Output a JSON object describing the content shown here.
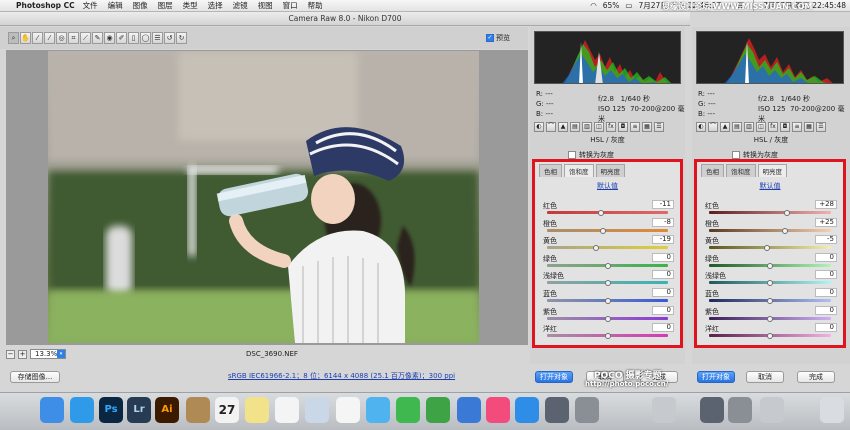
{
  "menubar": {
    "app_name": "Photoshop CC",
    "items": [
      "文件",
      "编辑",
      "图像",
      "图层",
      "类型",
      "选择",
      "滤镜",
      "视图",
      "窗口",
      "帮助"
    ],
    "battery": "65%",
    "clock_left": "7月27日 周三  22:46:17",
    "clock_right": "7月27日 周三  22:45:48",
    "watermark": "思缘设计论坛 WWW.MISSYUAN.COM"
  },
  "window": {
    "title": "Camera Raw 8.0 - Nikon D700"
  },
  "toolbar": {
    "tools": [
      "zoom-icon",
      "hand-icon",
      "white-balance-icon",
      "color-sampler-icon",
      "target-adjust-icon",
      "crop-icon",
      "straighten-icon",
      "spot-removal-icon",
      "red-eye-icon",
      "adjustment-brush-icon",
      "graduated-filter-icon",
      "radial-filter-icon",
      "preferences-icon",
      "rotate-ccw-icon",
      "rotate-cw-icon"
    ],
    "preview_label": "预览"
  },
  "canvas": {
    "filename": "DSC_3690.NEF",
    "zoom_value": "13.3%"
  },
  "bottom": {
    "save_label": "存储图像...",
    "workflow_info": "sRGB IEC61966-2.1；8 位；6144 x 4088 (25.1 百万像素)；300 ppi",
    "open_label": "打开对象",
    "cancel_label": "取消",
    "done_label": "完成",
    "watermark_url": "http://photo.poco.cn/",
    "watermark_brand": "POCO 摄影专题"
  },
  "exif": {
    "r": "R:  ---",
    "g": "G:  ---",
    "b": "B:  ---",
    "aperture": "f/2.8",
    "shutter": "1/640 秒",
    "iso": "ISO 125",
    "lens": "70-200@200 毫米"
  },
  "hsl_title": "HSL / 灰度",
  "grayscale_label": "转换为灰度",
  "default_label": "默认值",
  "tabs": [
    "色相",
    "饱和度",
    "明亮度"
  ],
  "saturation_panel": {
    "active_tab": 1,
    "rows": [
      {
        "label": "红色",
        "value": "-11",
        "level": -11,
        "color_from": "#c43a3a",
        "color_to": "#e06a6a"
      },
      {
        "label": "橙色",
        "value": "-8",
        "level": -8,
        "color_from": "#a88e6c",
        "color_to": "#e08a3a"
      },
      {
        "label": "黄色",
        "value": "-19",
        "level": -19,
        "color_from": "#a9a38c",
        "color_to": "#e0cf3a"
      },
      {
        "label": "绿色",
        "value": "0",
        "level": 0,
        "color_from": "#8fa18f",
        "color_to": "#3ab34a"
      },
      {
        "label": "浅绿色",
        "value": "0",
        "level": 0,
        "color_from": "#8fa1a1",
        "color_to": "#3ab3b3"
      },
      {
        "label": "蓝色",
        "value": "0",
        "level": 0,
        "color_from": "#8f96a6",
        "color_to": "#3a5ad6"
      },
      {
        "label": "紫色",
        "value": "0",
        "level": 0,
        "color_from": "#9b8fa6",
        "color_to": "#8a3ad6"
      },
      {
        "label": "洋红",
        "value": "0",
        "level": 0,
        "color_from": "#a68fa1",
        "color_to": "#d63ab3"
      }
    ]
  },
  "luminance_panel": {
    "active_tab": 2,
    "rows": [
      {
        "label": "红色",
        "value": "+28",
        "level": 28,
        "color_from": "#5a1f1f",
        "color_to": "#f4b0b0"
      },
      {
        "label": "橙色",
        "value": "+25",
        "level": 25,
        "color_from": "#5a3a1f",
        "color_to": "#f4d0b0"
      },
      {
        "label": "黄色",
        "value": "-5",
        "level": -5,
        "color_from": "#5a551f",
        "color_to": "#f4efb0"
      },
      {
        "label": "绿色",
        "value": "0",
        "level": 0,
        "color_from": "#1f5a25",
        "color_to": "#b0f4b8"
      },
      {
        "label": "浅绿色",
        "value": "0",
        "level": 0,
        "color_from": "#1f5a5a",
        "color_to": "#b0f4f4"
      },
      {
        "label": "蓝色",
        "value": "0",
        "level": 0,
        "color_from": "#1f2a5a",
        "color_to": "#b0c0f4"
      },
      {
        "label": "紫色",
        "value": "0",
        "level": 0,
        "color_from": "#3a1f5a",
        "color_to": "#d0b0f4"
      },
      {
        "label": "洋红",
        "value": "0",
        "level": 0,
        "color_from": "#5a1f4a",
        "color_to": "#f4b0e4"
      }
    ]
  },
  "dock": {
    "apps": [
      {
        "name": "finder-icon",
        "label": "",
        "color": "#3e8ee8"
      },
      {
        "name": "safari-icon",
        "label": "",
        "color": "#2f9be8"
      },
      {
        "name": "photoshop-icon",
        "label": "Ps",
        "color": "#0b2640"
      },
      {
        "name": "lightroom-icon",
        "label": "Lr",
        "color": "#273b52"
      },
      {
        "name": "illustrator-icon",
        "label": "Ai",
        "color": "#3b1a00"
      },
      {
        "name": "notebook-icon",
        "label": "",
        "color": "#b08a55"
      },
      {
        "name": "calendar-icon",
        "label": "27",
        "color": "#f2f2f2"
      },
      {
        "name": "notes-icon",
        "label": "",
        "color": "#f2e38a"
      },
      {
        "name": "reminders-icon",
        "label": "",
        "color": "#f4f4f4"
      },
      {
        "name": "preview-icon",
        "label": "",
        "color": "#c9d7e6"
      },
      {
        "name": "photos-icon",
        "label": "",
        "color": "#f5f5f5"
      },
      {
        "name": "messages-icon",
        "label": "",
        "color": "#4fb3f0"
      },
      {
        "name": "facetime-icon",
        "label": "",
        "color": "#3fb94f"
      },
      {
        "name": "numbers-icon",
        "label": "",
        "color": "#3da344"
      },
      {
        "name": "keynote-icon",
        "label": "",
        "color": "#3a7ad6"
      },
      {
        "name": "itunes-icon",
        "label": "",
        "color": "#f34b7b"
      },
      {
        "name": "appstore-icon",
        "label": "",
        "color": "#2e8de6"
      },
      {
        "name": "launchpad-icon",
        "label": "",
        "color": "#5b6270"
      },
      {
        "name": "system-prefs-icon",
        "label": "",
        "color": "#8a8f96"
      },
      {
        "name": "downloads-icon",
        "label": "",
        "color": "#c6c9cd"
      },
      {
        "name": "trash-icon",
        "label": "",
        "color": "#d9dce0"
      }
    ]
  }
}
